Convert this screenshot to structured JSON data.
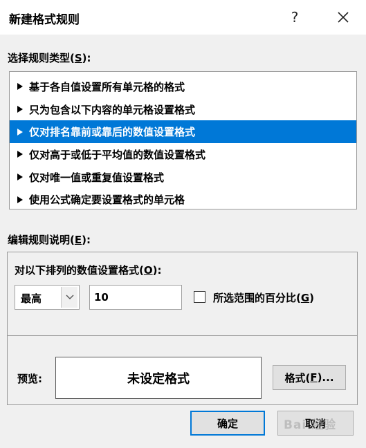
{
  "dialog": {
    "title": "新建格式规则",
    "help_glyph": "?"
  },
  "rule_type": {
    "label_before": "选择规则类型(",
    "label_key": "S",
    "label_after": "):",
    "items": [
      {
        "label": "基于各自值设置所有单元格的格式"
      },
      {
        "label": "只为包含以下内容的单元格设置格式"
      },
      {
        "label": "仅对排名靠前或靠后的数值设置格式",
        "selected": true
      },
      {
        "label": "仅对高于或低于平均值的数值设置格式"
      },
      {
        "label": "仅对唯一值或重复值设置格式"
      },
      {
        "label": "使用公式确定要设置格式的单元格"
      }
    ]
  },
  "edit": {
    "label_before": "编辑规则说明(",
    "label_key": "E",
    "label_after": "):",
    "format_label_before": "对以下排列的数值设置格式(",
    "format_label_key": "O",
    "format_label_after": "):",
    "rank_select_value": "最高",
    "rank_count": "10",
    "percent_label_before": "所选范围的百分比(",
    "percent_label_key": "G",
    "percent_label_after": ")",
    "percent_checked": false,
    "preview_label": "预览:",
    "preview_text": "未设定格式",
    "format_button_before": "格式(",
    "format_button_key": "F",
    "format_button_after": ")..."
  },
  "footer": {
    "ok_label": "确定",
    "cancel_label": "取消",
    "watermark": "Bai 经验"
  },
  "colors": {
    "selection": "#0078d7",
    "dialog_bg": "#f0f0f0"
  },
  "icons": {
    "close": "close-icon",
    "dropdown": "chevron-down-icon",
    "item_marker": "triangle-right-icon"
  }
}
